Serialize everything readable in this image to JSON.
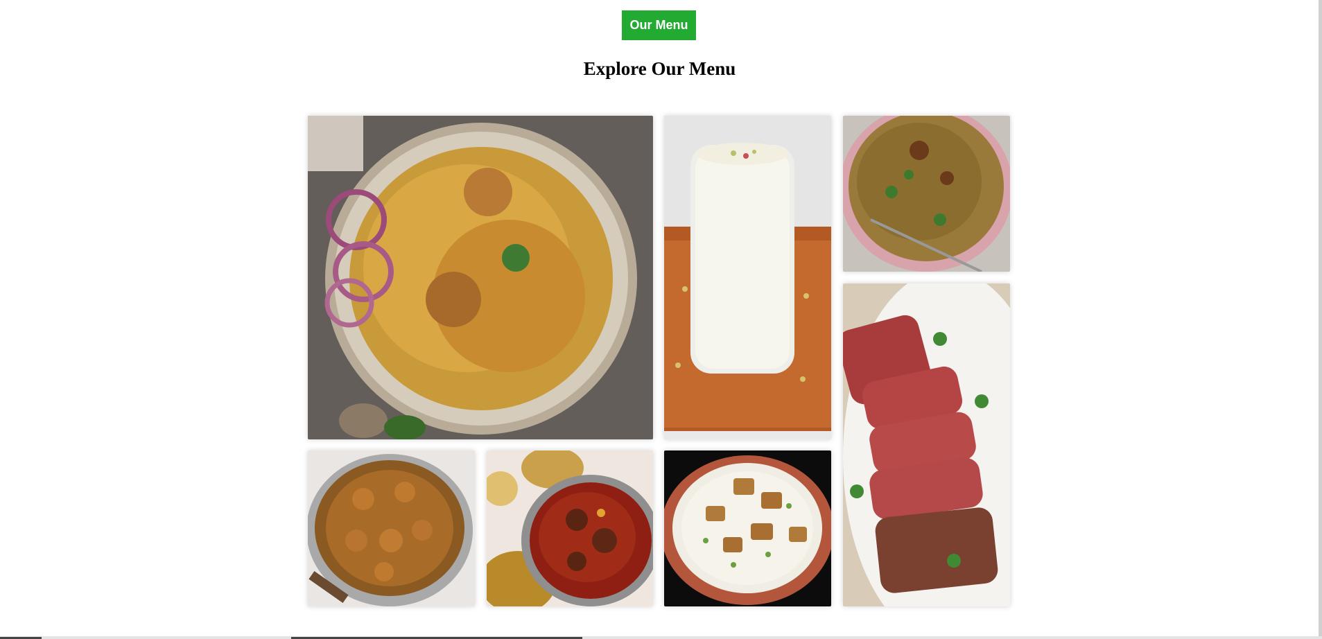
{
  "header": {
    "menu_button_label": "Our Menu",
    "title": "Explore Our Menu"
  },
  "gallery": {
    "items": [
      {
        "id": "biryani",
        "alt": "Chicken biryani"
      },
      {
        "id": "lassi",
        "alt": "Lassi"
      },
      {
        "id": "haleem",
        "alt": "Haleem"
      },
      {
        "id": "steak",
        "alt": "Sliced steak"
      },
      {
        "id": "chicken-curry",
        "alt": "Chicken curry"
      },
      {
        "id": "mutton-curry",
        "alt": "Mutton curry"
      },
      {
        "id": "paneer-pulao",
        "alt": "Paneer pulao"
      }
    ]
  },
  "colors": {
    "accent": "#22aa33",
    "background": "#ffffff",
    "heading": "#000000"
  }
}
